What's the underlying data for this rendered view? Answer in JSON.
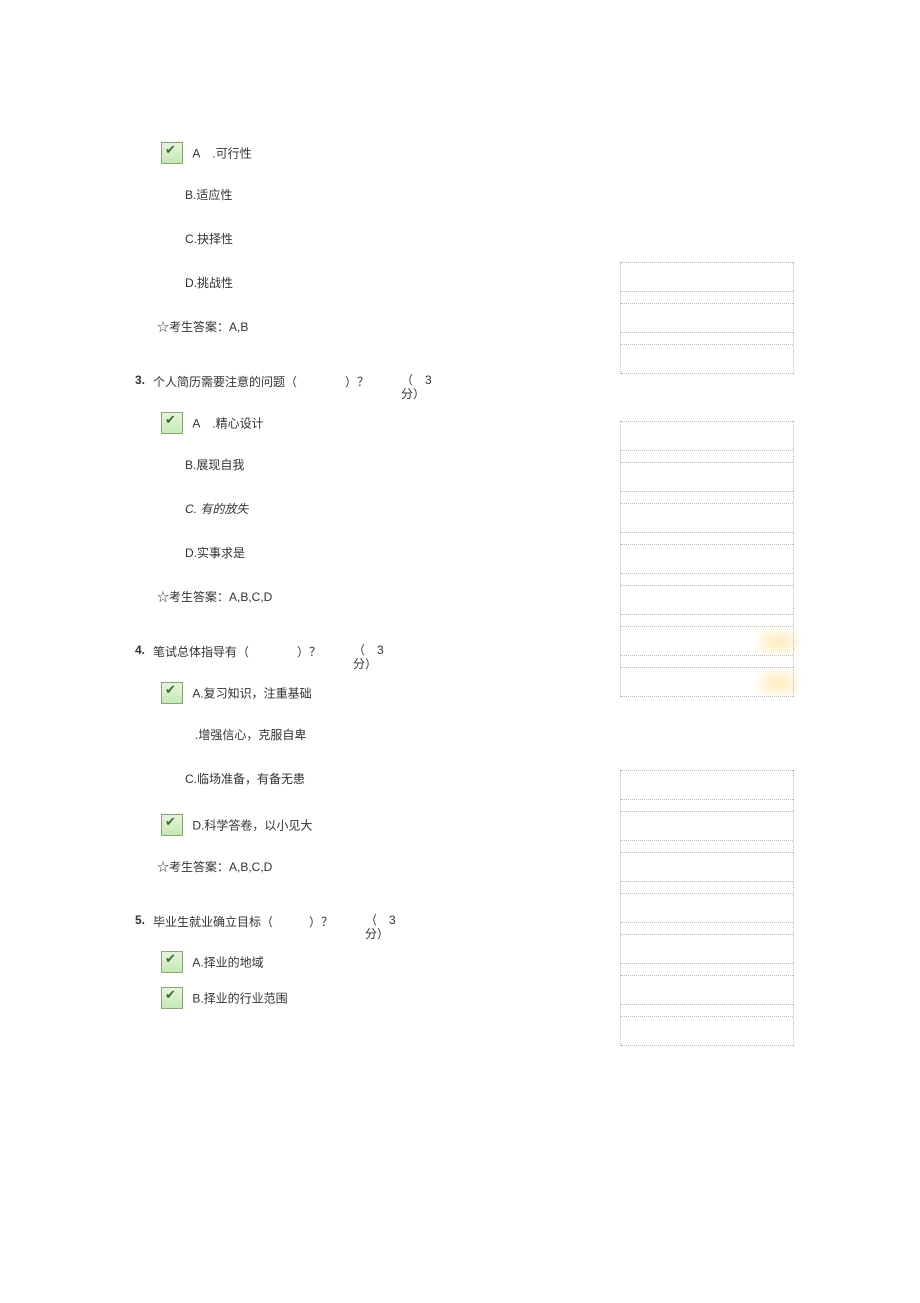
{
  "q2": {
    "options": {
      "A": "A .可行性",
      "B": "B.适应性",
      "C": "C.抉择性",
      "D": "D.挑战性"
    },
    "answer": "☆考生答案：A,B"
  },
  "q3": {
    "number": "3.",
    "text": "个人简历需要注意的问题（    ）？",
    "points_open": "（ 3",
    "points_close": "分）",
    "options": {
      "A": "A .精心设计",
      "B": "B.展现自我",
      "C": "C. 有的放失",
      "D": "D.实事求是"
    },
    "answer": "☆考生答案：A,B,C,D"
  },
  "q4": {
    "number": "4.",
    "text": "笔试总体指导有（    ）？",
    "points_open": "（ 3",
    "points_close": "分）",
    "options": {
      "A": "A.复习知识，注重基础",
      "B": ".增强信心，克服自卑",
      "C": "C.临场准备，有备无患",
      "D": "D.科学答卷，以小见大"
    },
    "answer": "☆考生答案：A,B,C,D"
  },
  "q5": {
    "number": "5.",
    "text": "毕业生就业确立目标（   ）？",
    "points_open": "（ 3",
    "points_close": "分）",
    "options": {
      "A": "A.择业的地域",
      "B": "B.择业的行业范围"
    }
  }
}
